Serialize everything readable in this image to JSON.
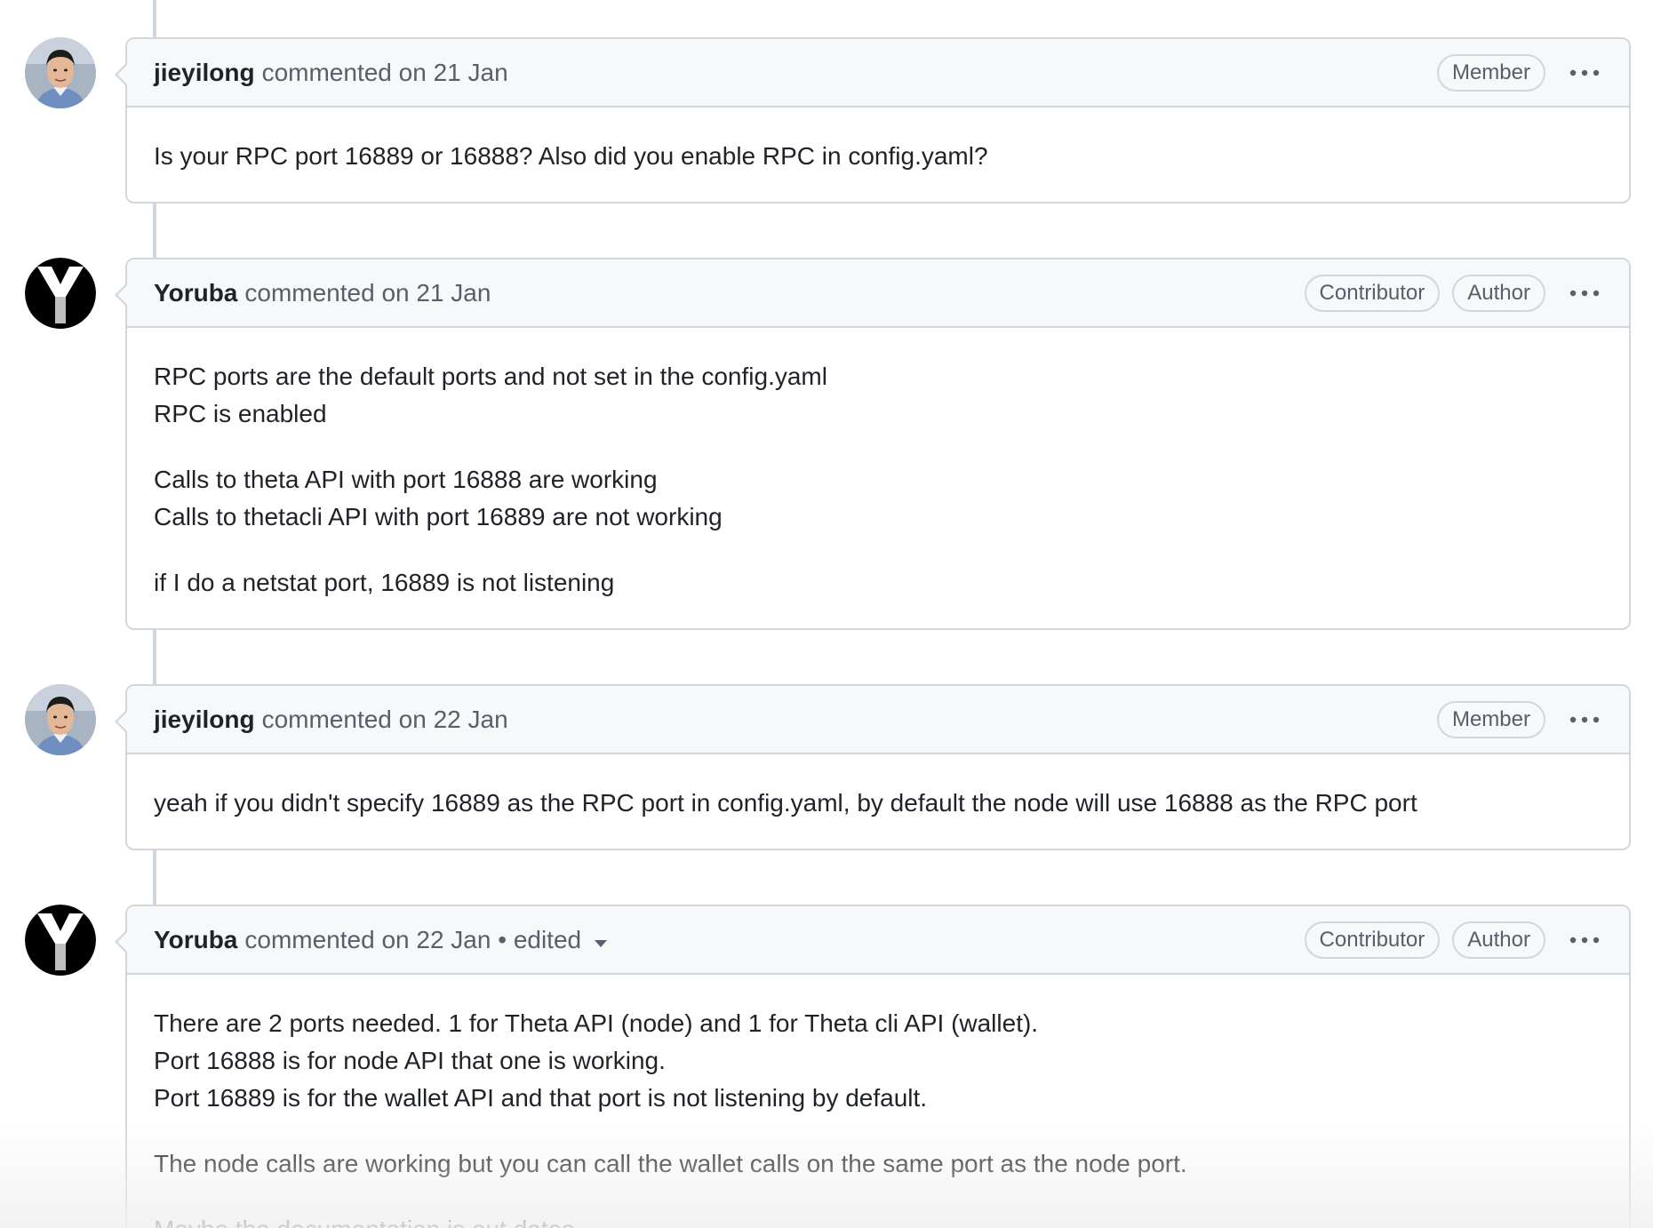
{
  "comments": [
    {
      "author": "jieyilong",
      "meta": "commented on 21 Jan",
      "badges": [
        "Member"
      ],
      "avatar": "photo",
      "paragraphs": [
        [
          "Is your RPC port 16889 or 16888? Also did you enable RPC in config.yaml?"
        ]
      ]
    },
    {
      "author": "Yoruba",
      "meta": "commented on 21 Jan",
      "badges": [
        "Contributor",
        "Author"
      ],
      "avatar": "Y-logo",
      "paragraphs": [
        [
          "RPC ports are the default ports and not set in the config.yaml",
          "RPC is enabled"
        ],
        [
          "Calls to theta API with port 16888 are working",
          "Calls to thetacli API with port 16889 are not working"
        ],
        [
          "if I do a netstat port, 16889 is not listening"
        ]
      ]
    },
    {
      "author": "jieyilong",
      "meta": "commented on 22 Jan",
      "badges": [
        "Member"
      ],
      "avatar": "photo",
      "paragraphs": [
        [
          "yeah if you didn't specify 16889 as the RPC port in config.yaml, by default the node will use 16888 as the RPC port"
        ]
      ]
    },
    {
      "author": "Yoruba",
      "meta": "commented on 22 Jan • edited",
      "badges": [
        "Contributor",
        "Author"
      ],
      "avatar": "Y-logo",
      "edited": true,
      "paragraphs": [
        [
          "There are 2 ports needed. 1 for Theta API (node) and 1 for Theta cli API (wallet).",
          "Port 16888 is for node API that one is working.",
          "Port 16889 is for the wallet API and that port is not listening by default."
        ],
        [
          "The node calls are working but you can call the wallet calls on the same port as the node port."
        ],
        [
          "Maybe the documentation is out dates"
        ]
      ]
    }
  ],
  "icons": {
    "kebab": "kebab-horizontal-icon",
    "caret": "triangle-down-icon"
  },
  "colors": {
    "border": "#d0d7de",
    "header_bg": "#f6f8fa",
    "muted": "#57606a"
  }
}
